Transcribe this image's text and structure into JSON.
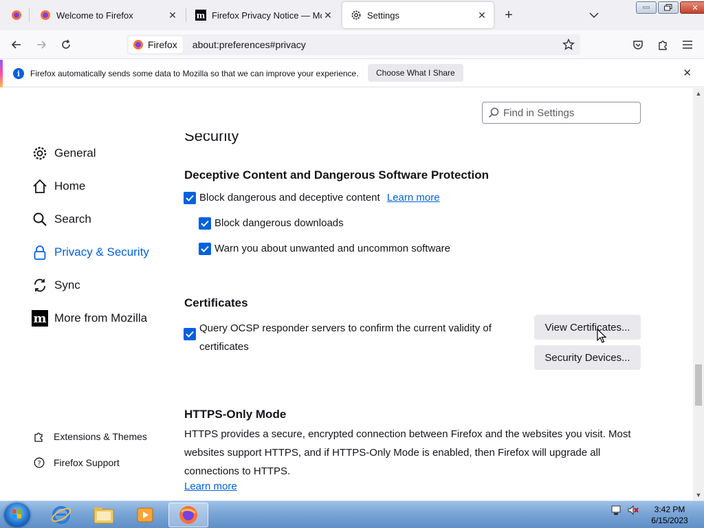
{
  "tabs": [
    {
      "title": "Welcome to Firefox",
      "icon": "firefox-icon"
    },
    {
      "title": "Firefox Privacy Notice — Mozilla",
      "icon": "mozilla-m-icon"
    },
    {
      "title": "Settings",
      "icon": "gear-icon"
    }
  ],
  "navbar": {
    "identity_label": "Firefox",
    "url": "about:preferences#privacy"
  },
  "notification": {
    "message": "Firefox automatically sends some data to Mozilla so that we can improve your experience.",
    "button_label": "Choose What I Share"
  },
  "search": {
    "placeholder": "Find in Settings"
  },
  "sidebar": {
    "categories": [
      {
        "label": "General",
        "icon": "gear-icon"
      },
      {
        "label": "Home",
        "icon": "home-icon"
      },
      {
        "label": "Search",
        "icon": "search-icon"
      },
      {
        "label": "Privacy & Security",
        "icon": "lock-icon",
        "selected": true
      },
      {
        "label": "Sync",
        "icon": "sync-icon"
      },
      {
        "label": "More from Mozilla",
        "icon": "mozilla-m-icon"
      }
    ],
    "footer": [
      {
        "label": "Extensions & Themes",
        "icon": "puzzle-icon"
      },
      {
        "label": "Firefox Support",
        "icon": "help-icon"
      }
    ]
  },
  "main": {
    "section_cut": "Security",
    "deceptive": {
      "heading": "Deceptive Content and Dangerous Software Protection",
      "block_deceptive": "Block dangerous and deceptive content",
      "learn_more": "Learn more",
      "block_downloads": "Block dangerous downloads",
      "warn_unwanted": "Warn you about unwanted and uncommon software"
    },
    "certificates": {
      "heading": "Certificates",
      "ocsp_line1": "Query OCSP responder servers to confirm the current validity of",
      "ocsp_line2": "certificates",
      "view_button": "View Certificates...",
      "devices_button": "Security Devices..."
    },
    "https": {
      "heading": "HTTPS-Only Mode",
      "description": "HTTPS provides a secure, encrypted connection between Firefox and the websites you visit. Most websites support HTTPS, and if HTTPS-Only Mode is enabled, then Firefox will upgrade all connections to HTTPS.",
      "learn_more": "Learn more"
    }
  },
  "taskbar": {
    "time": "3:42 PM",
    "date": "6/15/2023"
  },
  "colors": {
    "accent": "#0061e0",
    "tabstrip": "#f0f0f4"
  }
}
